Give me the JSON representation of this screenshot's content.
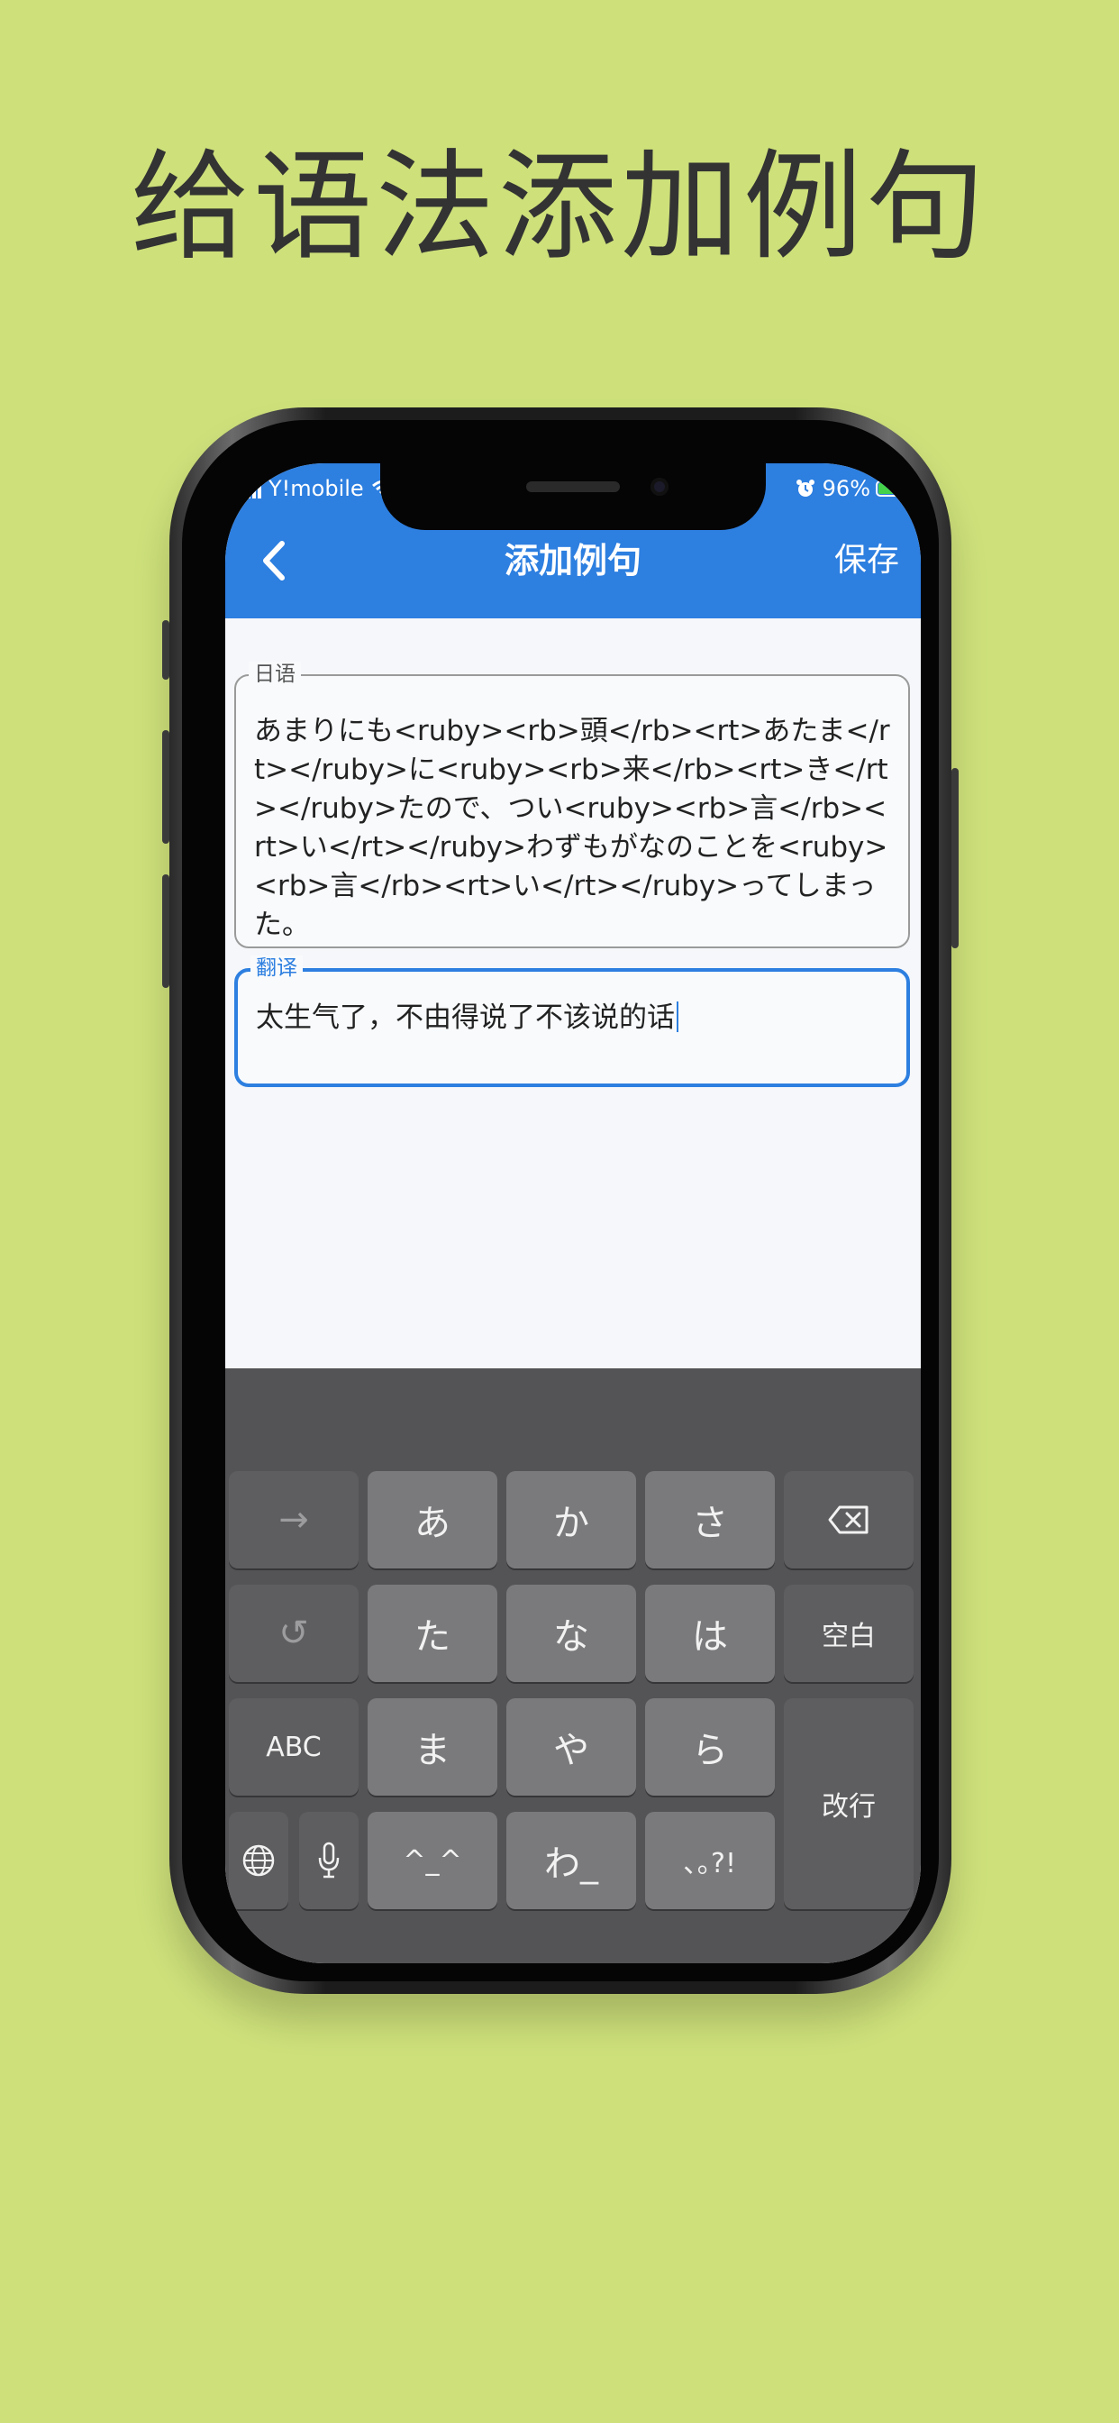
{
  "headline": "给语法添加例句",
  "status": {
    "carrier": "Y!mobile",
    "battery": "96%",
    "battery_level": 0.96
  },
  "appbar": {
    "title": "添加例句",
    "save_label": "保存"
  },
  "fields": {
    "japanese": {
      "label": "日语",
      "value": "あまりにも<ruby><rb>頭</rb><rt>あたま</rt></ruby>に<ruby><rb>来</rb><rt>き</rt></ruby>たので、つい<ruby><rb>言</rb><rt>い</rt></ruby>わずもがなのことを<ruby><rb>言</rb><rt>い</rt></ruby>ってしまった。"
    },
    "translation": {
      "label": "翻译",
      "value": "太生气了，不由得说了不该说的话"
    }
  },
  "keyboard": {
    "rows": [
      [
        "→",
        "あ",
        "か",
        "さ",
        "⌫"
      ],
      [
        "↺",
        "た",
        "な",
        "は",
        "空白"
      ],
      [
        "ABC",
        "ま",
        "や",
        "ら",
        "改行"
      ],
      [
        "globe",
        "mic",
        "^_^",
        "わ_",
        "､｡?!"
      ]
    ],
    "labels": {
      "arrow": "→",
      "a": "あ",
      "ka": "か",
      "sa": "さ",
      "undo": "↺",
      "ta": "た",
      "na": "な",
      "ha": "は",
      "space": "空白",
      "abc": "ABC",
      "ma": "ま",
      "ya": "や",
      "ra": "ら",
      "enter": "改行",
      "kaomoji": "^_^",
      "wa": "わ_",
      "punct": "､｡?!"
    }
  },
  "colors": {
    "background": "#cde07a",
    "accent": "#2d7fe0",
    "keyboard": "#545456"
  }
}
